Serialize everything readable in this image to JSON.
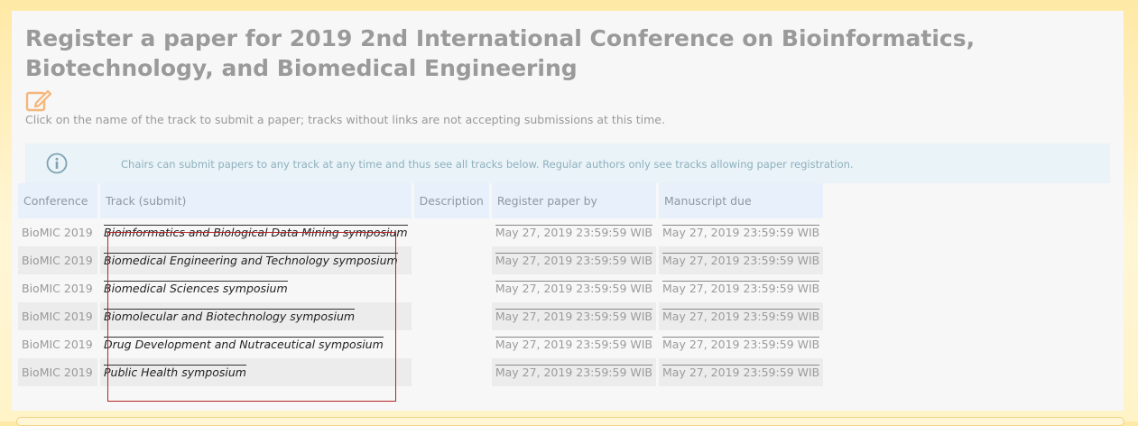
{
  "page": {
    "title": "Register a paper for 2019 2nd International Conference on Bioinformatics, Biotechnology, and Biomedical Engineering",
    "help_text": "Click on the name of the track to submit a paper; tracks without links are not accepting submissions at this time.",
    "info_text": "Chairs can submit papers to any track at any time and thus see all tracks below. Regular authors only see tracks allowing paper registration."
  },
  "icons": {
    "edit": "edit-icon",
    "info": "info-icon"
  },
  "colors": {
    "title": "#9a9a9a",
    "edit_icon": "#f5b67a",
    "info_bg": "#e9f3f8",
    "header_bg": "#e8f1fb",
    "outline": "#b5242a"
  },
  "table": {
    "headers": [
      "Conference",
      "Track (submit)",
      "Description",
      "Register paper by",
      "Manuscript due"
    ],
    "rows": [
      {
        "conference": "BioMIC 2019",
        "track": "Bioinformatics and Biological Data Mining symposium",
        "description": "",
        "register_by": "May 27, 2019 23:59:59 WIB",
        "manuscript_due": "May 27, 2019 23:59:59 WIB"
      },
      {
        "conference": "BioMIC 2019",
        "track": "Biomedical Engineering and Technology symposium",
        "description": "",
        "register_by": "May 27, 2019 23:59:59 WIB",
        "manuscript_due": "May 27, 2019 23:59:59 WIB"
      },
      {
        "conference": "BioMIC 2019",
        "track": "Biomedical Sciences symposium",
        "description": "",
        "register_by": "May 27, 2019 23:59:59 WIB",
        "manuscript_due": "May 27, 2019 23:59:59 WIB"
      },
      {
        "conference": "BioMIC 2019",
        "track": "Biomolecular and Biotechnology symposium",
        "description": "",
        "register_by": "May 27, 2019 23:59:59 WIB",
        "manuscript_due": "May 27, 2019 23:59:59 WIB"
      },
      {
        "conference": "BioMIC 2019",
        "track": "Drug Development and Nutraceutical symposium",
        "description": "",
        "register_by": "May 27, 2019 23:59:59 WIB",
        "manuscript_due": "May 27, 2019 23:59:59 WIB"
      },
      {
        "conference": "BioMIC 2019",
        "track": "Public Health symposium",
        "description": "",
        "register_by": "May 27, 2019 23:59:59 WIB",
        "manuscript_due": "May 27, 2019 23:59:59 WIB"
      }
    ]
  }
}
